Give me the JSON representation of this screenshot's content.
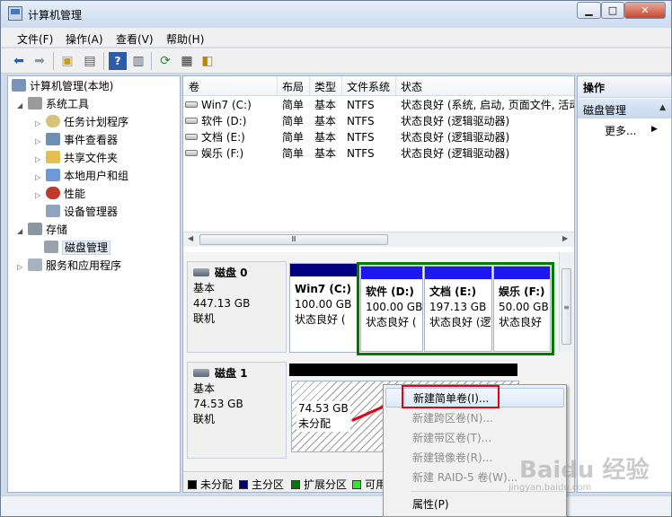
{
  "window": {
    "title": "计算机管理"
  },
  "menubar": [
    "文件(F)",
    "操作(A)",
    "查看(V)",
    "帮助(H)"
  ],
  "toolbar": {
    "buttons": [
      "back-icon",
      "forward-icon",
      "up-folder-icon",
      "show-tree-icon",
      "help-icon",
      "show-pane-icon",
      "refresh-icon",
      "properties-icon",
      "export-icon"
    ]
  },
  "tree": {
    "root": "计算机管理(本地)",
    "system_tools": "系统工具",
    "task_scheduler": "任务计划程序",
    "event_viewer": "事件查看器",
    "shared_folders": "共享文件夹",
    "local_users": "本地用户和组",
    "performance": "性能",
    "device_manager": "设备管理器",
    "storage": "存储",
    "disk_management": "磁盘管理",
    "services_apps": "服务和应用程序"
  },
  "volumes": {
    "columns": [
      "卷",
      "布局",
      "类型",
      "文件系统",
      "状态"
    ],
    "rows": [
      {
        "name": "Win7 (C:)",
        "layout": "简单",
        "type": "基本",
        "fs": "NTFS",
        "status": "状态良好 (系统, 启动, 页面文件, 活动"
      },
      {
        "name": "软件 (D:)",
        "layout": "简单",
        "type": "基本",
        "fs": "NTFS",
        "status": "状态良好 (逻辑驱动器)"
      },
      {
        "name": "文档 (E:)",
        "layout": "简单",
        "type": "基本",
        "fs": "NTFS",
        "status": "状态良好 (逻辑驱动器)"
      },
      {
        "name": "娱乐 (F:)",
        "layout": "简单",
        "type": "基本",
        "fs": "NTFS",
        "status": "状态良好 (逻辑驱动器)"
      }
    ],
    "hscroll_glyph": "Ⅲ"
  },
  "disks": {
    "disk0": {
      "name": "磁盘 0",
      "type": "基本",
      "size": "447.13 GB",
      "state": "联机",
      "partitions": [
        {
          "name": "Win7  (C:)",
          "size": "100.00 GB",
          "status": "状态良好 ("
        },
        {
          "name": "软件  (D:)",
          "size": "100.00 GB",
          "status": "状态良好 ("
        },
        {
          "name": "文档  (E:)",
          "size": "197.13 GB",
          "status": "状态良好 (逻"
        },
        {
          "name": "娱乐  (F:)",
          "size": "50.00 GB",
          "status": "状态良好"
        }
      ]
    },
    "disk1": {
      "name": "磁盘 1",
      "type": "基本",
      "size": "74.53 GB",
      "state": "联机",
      "unallocated": {
        "size": "74.53 GB",
        "label": "未分配"
      }
    }
  },
  "legend": [
    {
      "label": "未分配",
      "color": "#000000"
    },
    {
      "label": "主分区",
      "color": "#000080"
    },
    {
      "label": "扩展分区",
      "color": "#007a00"
    },
    {
      "label": "可用",
      "color": "#2ee82e"
    }
  ],
  "actions": {
    "header": "操作",
    "section": "磁盘管理",
    "more": "更多..."
  },
  "context_menu": {
    "items": [
      {
        "label": "新建简单卷(I)...",
        "enabled": true
      },
      {
        "label": "新建跨区卷(N)...",
        "enabled": false
      },
      {
        "label": "新建带区卷(T)...",
        "enabled": false
      },
      {
        "label": "新建镜像卷(R)...",
        "enabled": false
      },
      {
        "label": "新建 RAID-5 卷(W)...",
        "enabled": false
      },
      {
        "label": "属性(P)",
        "enabled": true
      }
    ]
  },
  "colors": {
    "primary": "#000080",
    "extended": "#007a00",
    "annotation": "#e60012"
  },
  "watermark": {
    "text": "Baidu 经验",
    "sub": "jingyan.baidu.com"
  }
}
